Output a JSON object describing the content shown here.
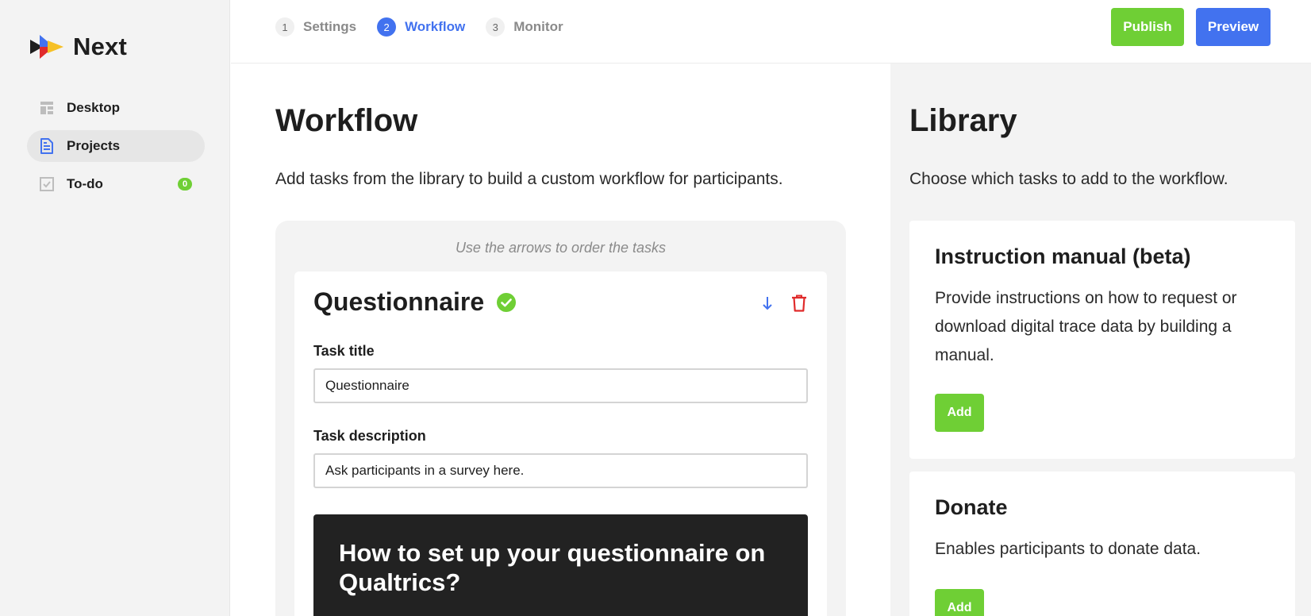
{
  "app": {
    "name": "Next"
  },
  "sidebar": {
    "items": [
      {
        "label": "Desktop",
        "icon": "desktop-icon"
      },
      {
        "label": "Projects",
        "icon": "document-icon",
        "active": true
      },
      {
        "label": "To-do",
        "icon": "checkbox-icon",
        "badge": "0"
      }
    ]
  },
  "steps": [
    {
      "number": "1",
      "label": "Settings"
    },
    {
      "number": "2",
      "label": "Workflow",
      "active": true
    },
    {
      "number": "3",
      "label": "Monitor"
    }
  ],
  "toolbar": {
    "publish_label": "Publish",
    "preview_label": "Preview"
  },
  "workflow": {
    "title": "Workflow",
    "description": "Add tasks from the library to build a custom workflow for participants.",
    "hint": "Use the arrows to order the tasks",
    "task": {
      "title": "Questionnaire",
      "title_label": "Task title",
      "title_value": "Questionnaire",
      "description_label": "Task description",
      "description_value": "Ask participants in a survey here.",
      "info_heading": "How to set up your questionnaire on Qualtrics?"
    }
  },
  "library": {
    "title": "Library",
    "description": "Choose which tasks to add to the workflow.",
    "cards": [
      {
        "title": "Instruction manual (beta)",
        "description": "Provide instructions on how to request or download digital trace data by building a manual.",
        "add_label": "Add"
      },
      {
        "title": "Donate",
        "description": "Enables participants to donate data.",
        "add_label": "Add"
      }
    ]
  },
  "colors": {
    "green": "#6fcf35",
    "blue": "#4272ef",
    "red": "#e02b2b",
    "dark": "#222222"
  }
}
